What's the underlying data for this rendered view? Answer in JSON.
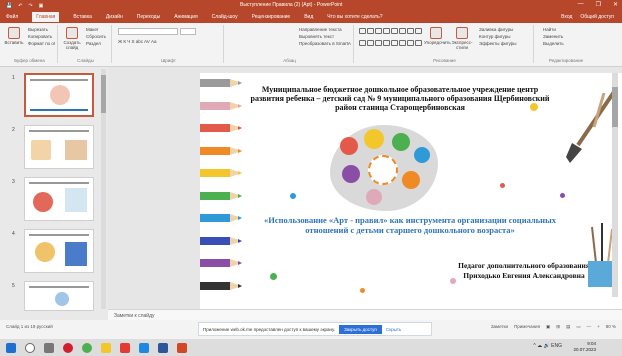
{
  "window": {
    "title": "Выступление Правила (2) (Apt) - PowerPoint",
    "quick_access": [
      "💾",
      "↶",
      "↷",
      "▣"
    ],
    "controls": [
      "—",
      "❐",
      "✕"
    ]
  },
  "ribbon_tabs": {
    "items": [
      "Файл",
      "Главная",
      "Вставка",
      "Дизайн",
      "Переходы",
      "Анимация",
      "Слайд-шоу",
      "Рецензирование",
      "Вид",
      "Что вы хотите сделать?"
    ],
    "active": "Главная",
    "right": [
      "Вход",
      "Общий доступ"
    ]
  },
  "ribbon": {
    "clipboard": {
      "paste": "Вставить",
      "cut": "Вырезать",
      "copy": "Копировать",
      "format": "Формат по образцу",
      "label": "Буфер обмена"
    },
    "slides": {
      "create": "Создать слайд",
      "layout": "Макет",
      "reset": "Сбросить",
      "section": "Раздел",
      "label": "Слайды"
    },
    "font": {
      "label": "Шрифт",
      "bold": "Ж К Ч S abc AV Аа"
    },
    "paragraph": {
      "label": "Абзац",
      "dir": "Направление текста",
      "align": "Выровнять текст",
      "smart": "Преобразовать в SmartArt"
    },
    "drawing": {
      "label": "Рисование",
      "arrange": "Упорядочить",
      "quick": "Экспресс-стили",
      "fill": "Заливка фигуры",
      "outline": "Контур фигуры",
      "effects": "Эффекты фигуры"
    },
    "editing": {
      "label": "Редактирование",
      "find": "Найти",
      "replace": "Заменить",
      "select": "Выделить"
    }
  },
  "slide_numbers": [
    "1",
    "2",
    "3",
    "4",
    "5"
  ],
  "slide": {
    "heading": "Муниципальное бюджетное дошкольное образовательное учреждение центр развития ребенка – детский сад № 9 муниципального образования Щербиновский район станица Старощербиновская",
    "project": "«Использование «Арт - правил» как инструмента организации социальных отношений с детьми старшего дошкольного возраста»",
    "teacher_role": "Педагог дополнительного образования",
    "teacher_name": "Приходько Евгения Александровна",
    "pencil_colors": [
      "#9a9a9a",
      "#e0a9b7",
      "#e35a4a",
      "#f08a24",
      "#f3c72c",
      "#4caf50",
      "#2e9ad8",
      "#3a4eb8",
      "#8b4ea6",
      "#333333"
    ]
  },
  "notes": {
    "placeholder": "Заметки к слайду"
  },
  "notification": {
    "text": "Приложение web.ok.me предоставлен доступ к вашему экрану.",
    "primary": "Закрыть доступ",
    "secondary": "Скрыть"
  },
  "status": {
    "left": "Слайд 1 из 19   русский",
    "right": [
      "Заметки",
      "Примечания",
      "▣",
      "⊞",
      "▤",
      "▭",
      "—",
      "+",
      "80 %"
    ]
  },
  "taskbar": {
    "icons": [
      "start-icon",
      "search-icon",
      "taskview-icon",
      "opera-icon",
      "chrome-icon",
      "explorer-icon",
      "yandex-icon",
      "mail-icon",
      "word-icon",
      "powerpoint-icon"
    ],
    "time": "9:04",
    "date": "20.07.2023",
    "tray": "^ ☁ 🔊 ENG"
  }
}
